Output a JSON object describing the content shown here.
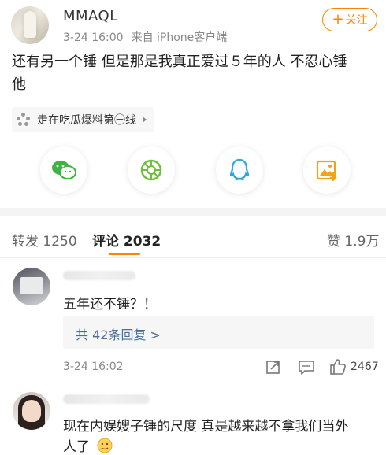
{
  "post": {
    "username": "MMAQL",
    "time": "3-24 16:00",
    "source": "来自 iPhone客户端",
    "follow_label": "关注",
    "text_line1": "还有另一个锤 但是那是我真正爱过５年的人 不忍心锤",
    "text_line2": "他",
    "topic": "走在吃瓜爆料第㊀线"
  },
  "share_icons": [
    "wechat-icon",
    "moments-icon",
    "qq-icon",
    "save-image-icon"
  ],
  "tabs": {
    "repost": "转发 1250",
    "comment": "评论 2032",
    "like": "赞 1.9万"
  },
  "colors": {
    "accent": "#ff8200",
    "link": "#4a6e9a"
  },
  "comments": [
    {
      "text": "五年还不锤？！",
      "replies": "共 42条回复 >",
      "time": "3-24 16:02",
      "likes": "2467"
    },
    {
      "text_line1": "现在内娱嫂子锤的尺度 真是越来越不拿我们当外",
      "text_line2": "人了"
    }
  ]
}
